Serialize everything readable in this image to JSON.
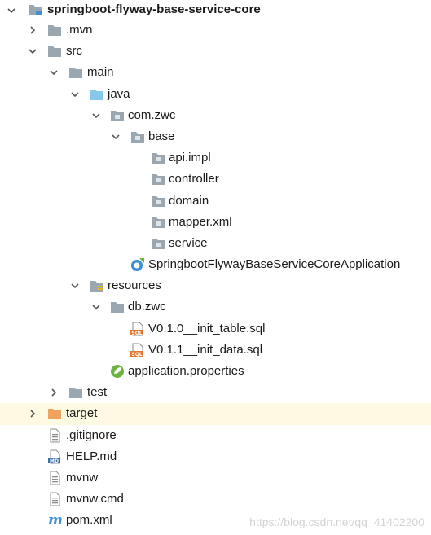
{
  "tree": {
    "root": "springboot-flyway-base-service-core",
    "mvn": ".mvn",
    "src": "src",
    "main": "main",
    "java": "java",
    "com_zwc": "com.zwc",
    "base": "base",
    "api_impl": "api.impl",
    "controller": "controller",
    "domain": "domain",
    "mapper_xml": "mapper.xml",
    "service": "service",
    "application_class": "SpringbootFlywayBaseServiceCoreApplication",
    "resources": "resources",
    "db_zwc": "db.zwc",
    "sql_init_table": "V0.1.0__init_table.sql",
    "sql_init_data": "V0.1.1__init_data.sql",
    "application_properties": "application.properties",
    "test": "test",
    "target": "target",
    "gitignore": ".gitignore",
    "help_md": "HELP.md",
    "mvnw": "mvnw",
    "mvnw_cmd": "mvnw.cmd",
    "pom_xml": "pom.xml"
  },
  "watermark": "https://blog.csdn.net/qq_41402200",
  "colors": {
    "folder_gray": "#9aa7b0",
    "folder_source": "#87c7e8",
    "folder_target": "#f0a35e",
    "spring_green": "#6db33f",
    "sql_orange": "#e3762c",
    "highlight_row": "#fdf9e3"
  }
}
